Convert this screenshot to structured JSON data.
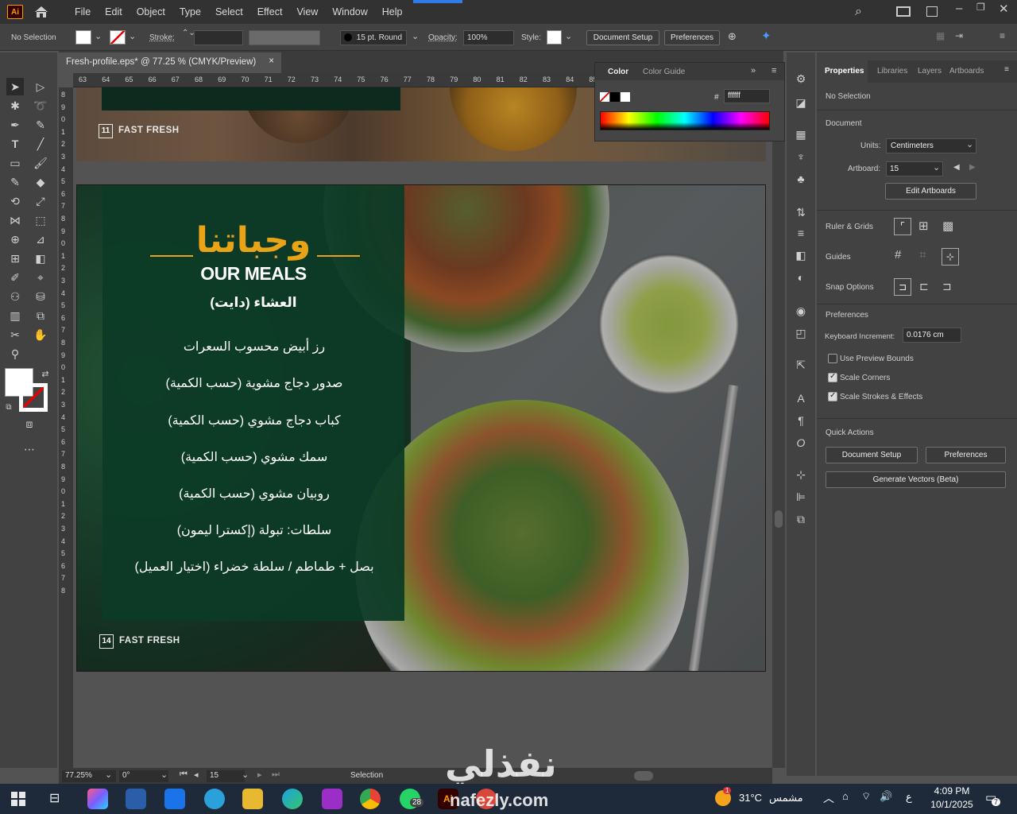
{
  "app": {
    "logo": "Ai",
    "home_icon": "home-icon"
  },
  "menu": [
    "File",
    "Edit",
    "Object",
    "Type",
    "Select",
    "Effect",
    "View",
    "Window",
    "Help"
  ],
  "control": {
    "selection": "No Selection",
    "stroke_label": "Stroke:",
    "brush": "15 pt. Round",
    "opacity_label": "Opacity:",
    "opacity_value": "100%",
    "style_label": "Style:",
    "doc_setup": "Document Setup",
    "preferences": "Preferences"
  },
  "document": {
    "tab_title": "Fresh-profile.eps* @ 77.25 % (CMYK/Preview)",
    "close": "×"
  },
  "ruler_top": [
    "63",
    "64",
    "65",
    "66",
    "67",
    "68",
    "69",
    "70",
    "71",
    "72",
    "73",
    "74",
    "75",
    "76",
    "77",
    "78",
    "79",
    "80",
    "81",
    "82",
    "83",
    "84",
    "85"
  ],
  "ruler_left": [
    "8",
    "9",
    "0",
    "1",
    "2",
    "3",
    "4",
    "5",
    "6",
    "7",
    "8",
    "9",
    "0",
    "1",
    "2",
    "3",
    "4",
    "5",
    "6",
    "7",
    "8",
    "9",
    "0",
    "1",
    "2",
    "3",
    "4",
    "5",
    "6",
    "7",
    "8",
    "9",
    "0",
    "1",
    "2",
    "3",
    "4",
    "5",
    "6",
    "7",
    "8"
  ],
  "artboard_top": {
    "page_num": "11",
    "brand": "FAST FRESH"
  },
  "artboard_main": {
    "title_ar": "وجباتنا",
    "title_en": "OUR MEALS",
    "subtitle_ar": "العشاء (دايت)",
    "items": [
      "رز أبيض محسوب السعرات",
      "صدور دجاج مشوية (حسب الكمية)",
      "كباب دجاج مشوي (حسب الكمية)",
      "سمك مشوي (حسب الكمية)",
      "روبيان مشوي (حسب الكمية)",
      "سلطات: تبولة (إكسترا ليمون)",
      "بصل + طماطم / سلطة خضراء (اختيار العميل)"
    ],
    "page_num": "14",
    "brand": "FAST FRESH",
    "accent_color": "#e8a317",
    "panel_color": "#0c3a26"
  },
  "color_panel": {
    "tab1": "Color",
    "tab2": "Color Guide",
    "hash": "#",
    "hex_value": "ffffff"
  },
  "status": {
    "zoom": "77.25%",
    "rotate": "0°",
    "artboard": "15",
    "mode": "Selection"
  },
  "props": {
    "tabs": [
      "Properties",
      "Libraries",
      "Layers",
      "Artboards"
    ],
    "no_selection": "No Selection",
    "document": "Document",
    "units_label": "Units:",
    "units_value": "Centimeters",
    "artboard_label": "Artboard:",
    "artboard_value": "15",
    "edit_artboards": "Edit Artboards",
    "ruler_grids": "Ruler & Grids",
    "guides": "Guides",
    "snap_options": "Snap Options",
    "preferences": "Preferences",
    "keyboard_inc_label": "Keyboard Increment:",
    "keyboard_inc_value": "0.0176 cm",
    "use_preview_bounds": "Use Preview Bounds",
    "scale_corners": "Scale Corners",
    "scale_strokes": "Scale Strokes & Effects",
    "quick_actions": "Quick Actions",
    "qa_doc_setup": "Document Setup",
    "qa_preferences": "Preferences",
    "qa_generate": "Generate Vectors (Beta)"
  },
  "watermark": {
    "ar": "نفذلي",
    "en": "nafezly.com"
  },
  "taskbar": {
    "weather_temp": "31°C",
    "weather_text": "مشمس",
    "lang": "ع",
    "time": "4:09 PM",
    "date": "10/1/2025",
    "whatsapp_badge": "28",
    "notif_badge": "7",
    "weather_badge": "1"
  }
}
